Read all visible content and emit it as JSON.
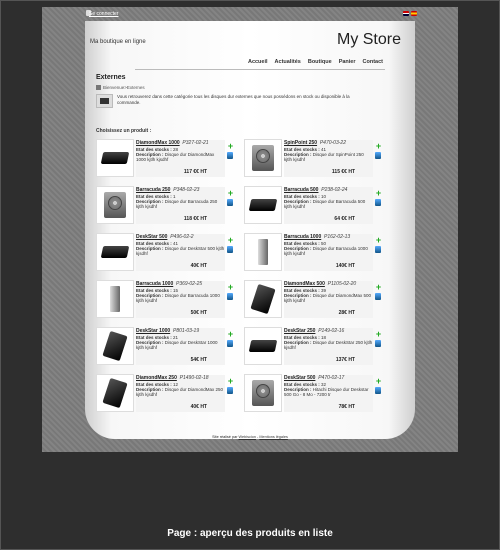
{
  "topbar": {
    "login": "Se connecter"
  },
  "header": {
    "tagline": "Ma boutique en ligne",
    "store_name": "My Store"
  },
  "nav": [
    "Accueil",
    "Actualités",
    "Boutique",
    "Panier",
    "Contact"
  ],
  "category": {
    "title": "Externes",
    "breadcrumb": "Bienvenue>Externes",
    "description": "Vous retrouverez dans cette catégorie tous les disques dur externes que nous possédons en stock ou disponible à la commande."
  },
  "choose_label": "Choisissez un produit :",
  "labels": {
    "stock": "Etat des stocks :",
    "desc": "Description :"
  },
  "products": [
    {
      "name": "DiamondMax 1000",
      "ref": "P327-02-21",
      "stock": "28",
      "desc": "Disque dur DiamondMax 1000 kjtlh kjsdhf",
      "price": "117 €€ HT",
      "img": "box"
    },
    {
      "name": "SpinPoint 250",
      "ref": "P470-03-22",
      "stock": "41",
      "desc": "Disque dur SpinPoint 250 kjtlh kjsdhf",
      "price": "115 €€ HT",
      "img": "hdd"
    },
    {
      "name": "Barracuda 250",
      "ref": "P348-02-23",
      "stock": "1",
      "desc": "Disque dur Barracuda 250 kjtlh kjsdhf",
      "price": "118 €€ HT",
      "img": "hdd"
    },
    {
      "name": "Barracuda 500",
      "ref": "P238-02-24",
      "stock": "10",
      "desc": "Disque dur Barracuda 500 kjtlh kjsdhf",
      "price": "64 €€ HT",
      "img": "box"
    },
    {
      "name": "DeskStar 500",
      "ref": "P496-02-2",
      "stock": "41",
      "desc": "Disque dur DeskStar 500 kjtlh kjsdhf",
      "price": "40€ HT",
      "img": "box"
    },
    {
      "name": "Barracuda 1000",
      "ref": "P162-02-13",
      "stock": "50",
      "desc": "Disque dur Barracuda 1000 kjtlh kjsdhf",
      "price": "140€ HT",
      "img": "tower"
    },
    {
      "name": "Barracuda 1000",
      "ref": "P369-02-25",
      "stock": "15",
      "desc": "Disque dur Barracuda 1000 kjtlh kjsdhf",
      "price": "50€ HT",
      "img": "tower"
    },
    {
      "name": "DiamondMax 500",
      "ref": "P1105-02-20",
      "stock": "39",
      "desc": "Disque dur DiamondMax 500 kjtlh kjsdhf",
      "price": "28€ HT",
      "img": "slab"
    },
    {
      "name": "DeskStar 1000",
      "ref": "P801-03-19",
      "stock": "21",
      "desc": "Disque dur DeskStar 1000 kjtlh kjsdhf",
      "price": "54€ HT",
      "img": "slab"
    },
    {
      "name": "DeskStar 250",
      "ref": "P149-02-16",
      "stock": "18",
      "desc": "Disque dur DeskStar 250 kjtlh kjsdhf",
      "price": "137€ HT",
      "img": "box"
    },
    {
      "name": "DiamondMax 250",
      "ref": "P1490-02-18",
      "stock": "12",
      "desc": "Disque dur DiamondMax 250 kjtlh kjsdhf",
      "price": "40€ HT",
      "img": "slab"
    },
    {
      "name": "DeskStar 500",
      "ref": "P470-02-17",
      "stock": "32",
      "desc": "Hitachi Disque dur Deskstar 500 Go - 8 Mo - 7200 tr",
      "price": "78€ HT",
      "img": "hdd"
    }
  ],
  "footer": {
    "text": "Site réalisé par",
    "link1": "Webiscion",
    "sep": " - ",
    "link2": "Mentions légales"
  },
  "caption": "Page : aperçu des produits en liste"
}
